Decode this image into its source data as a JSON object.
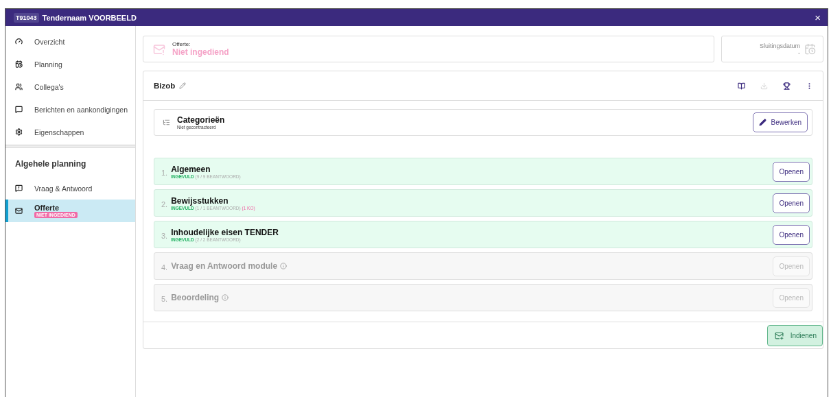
{
  "window": {
    "code": "T91043",
    "title": "Tendernaam VOORBEELD",
    "close": "×"
  },
  "sidebar": {
    "items": [
      {
        "label": "Overzicht",
        "selected": false
      },
      {
        "label": "Planning",
        "selected": false
      },
      {
        "label": "Collega's",
        "selected": false
      },
      {
        "label": "Berichten en aankondigingen",
        "selected": false
      },
      {
        "label": "Eigenschappen",
        "selected": false
      }
    ],
    "section_title": "Algehele planning",
    "planning_items": [
      {
        "label": "Vraag & Antwoord",
        "selected": false
      },
      {
        "label": "Offerte",
        "selected": true,
        "badge": "NIET INGEDIEND"
      }
    ]
  },
  "status_card": {
    "label": "Offerte:",
    "value": "Niet ingediend"
  },
  "closing_card": {
    "label": "Sluitingsdatum",
    "value": "-"
  },
  "panel": {
    "title": "Bizob",
    "toolbar": [
      {
        "disabled": false
      },
      {
        "disabled": true
      },
      {
        "disabled": false
      },
      {
        "disabled": false
      }
    ],
    "categories": {
      "title": "Categorieën",
      "subtitle": "Niet gecontracteerd",
      "button": "Bewerken"
    },
    "sections": [
      {
        "number": "1.",
        "title": "Algemeen",
        "disabled": false,
        "status": "INGEVULD",
        "count": "(9 / 9 BEANTWOORD)",
        "button": "Openen"
      },
      {
        "number": "2.",
        "title": "Bewijsstukken",
        "disabled": false,
        "status": "INGEVULD",
        "count": "(1 / 1 BEANTWOORD)",
        "ko": "(1 KO)",
        "button": "Openen"
      },
      {
        "number": "3.",
        "title": "Inhoudelijke eisen TENDER",
        "disabled": false,
        "status": "INGEVULD",
        "count": "(2 / 2 BEANTWOORD)",
        "button": "Openen"
      },
      {
        "number": "4.",
        "title": "Vraag en Antwoord module",
        "disabled": true,
        "info": true,
        "button": "Openen"
      },
      {
        "number": "5.",
        "title": "Beoordeling",
        "disabled": true,
        "info": true,
        "button": "Openen"
      }
    ],
    "submit": "Indienen"
  }
}
